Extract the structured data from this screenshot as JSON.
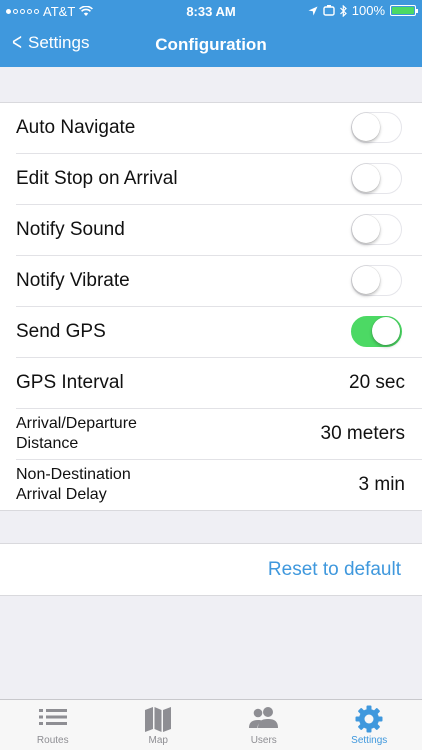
{
  "status_bar": {
    "carrier": "AT&T",
    "time": "8:33 AM",
    "battery": "100%"
  },
  "nav": {
    "back_label": "Settings",
    "title": "Configuration"
  },
  "settings": [
    {
      "label": "Auto Navigate",
      "type": "toggle",
      "on": false
    },
    {
      "label": "Edit Stop on Arrival",
      "type": "toggle",
      "on": false
    },
    {
      "label": "Notify Sound",
      "type": "toggle",
      "on": false
    },
    {
      "label": "Notify Vibrate",
      "type": "toggle",
      "on": false
    },
    {
      "label": "Send GPS",
      "type": "toggle",
      "on": true
    },
    {
      "label": "GPS Interval",
      "type": "value",
      "value": "20 sec"
    },
    {
      "label": "Arrival/Departure Distance",
      "type": "value",
      "value": "30 meters"
    },
    {
      "label": "Non-Destination Arrival Delay",
      "type": "value",
      "value": "3 min"
    }
  ],
  "reset_label": "Reset to default",
  "tabs": [
    {
      "label": "Routes",
      "icon": "list-icon",
      "active": false
    },
    {
      "label": "Map",
      "icon": "map-icon",
      "active": false
    },
    {
      "label": "Users",
      "icon": "users-icon",
      "active": false
    },
    {
      "label": "Settings",
      "icon": "gear-icon",
      "active": true
    }
  ],
  "colors": {
    "accent": "#3f98dd",
    "toggle_on": "#4cd964",
    "tab_inactive": "#8e8e93"
  }
}
